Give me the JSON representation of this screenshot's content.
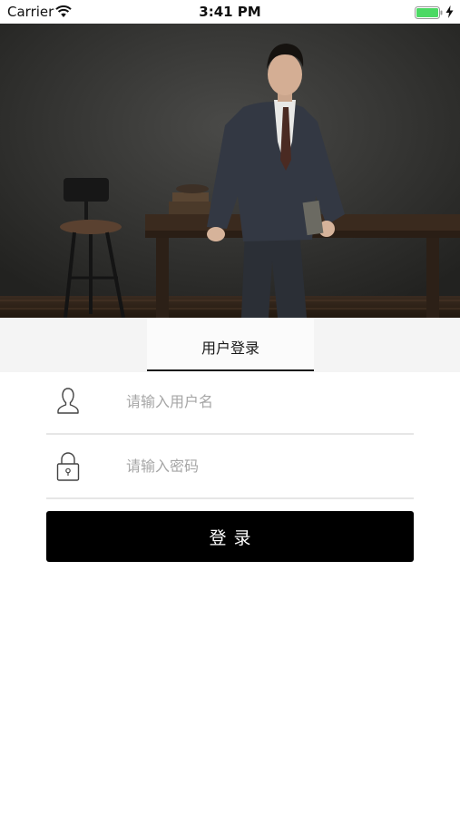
{
  "status_bar": {
    "carrier": "Carrier",
    "time": "3:41 PM",
    "battery_color": "#4cd964"
  },
  "hero": {
    "icon": "man-in-suit-photo"
  },
  "tabs": {
    "login_label": "用户登录"
  },
  "form": {
    "username_placeholder": "请输入用户名",
    "password_placeholder": "请输入密码",
    "username_icon": "user-icon",
    "password_icon": "lock-icon",
    "login_button": "登录"
  },
  "colors": {
    "accent": "#000000",
    "tab_background": "#f4f4f4",
    "divider": "#e6e6e6",
    "placeholder": "#a6a6a6"
  }
}
